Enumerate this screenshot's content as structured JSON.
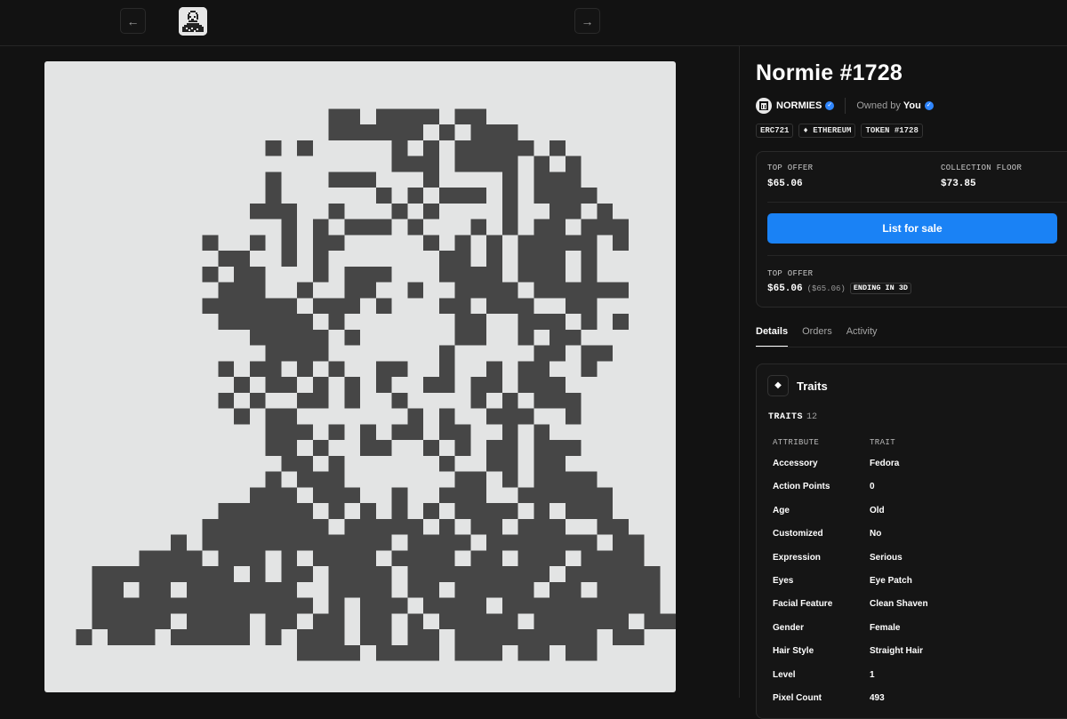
{
  "nav": {
    "prev_icon": "arrow-left-icon",
    "next_icon": "arrow-right-icon",
    "prev_glyph": "←",
    "next_glyph": "→"
  },
  "nft": {
    "title": "Normie #1728",
    "collection": "NORMIES",
    "owned_by_label": "Owned by",
    "owner": "You",
    "tags": [
      "ERC721",
      "ETHEREUM",
      "TOKEN #1728"
    ],
    "eth_glyph": "♦"
  },
  "offer": {
    "top_offer_label": "TOP OFFER",
    "top_offer_value": "$65.06",
    "floor_label": "COLLECTION FLOOR",
    "floor_value": "$73.85",
    "list_button": "List for sale",
    "bottom_label": "TOP OFFER",
    "bottom_value": "$65.06",
    "bottom_sub": "($65.06)",
    "ending": "ENDING IN 3D"
  },
  "tabs": [
    "Details",
    "Orders",
    "Activity"
  ],
  "traits": {
    "title": "Traits",
    "count_label": "TRAITS",
    "count": "12",
    "col_attribute": "ATTRIBUTE",
    "col_trait": "TRAIT",
    "rows": [
      {
        "attribute": "Accessory",
        "trait": "Fedora"
      },
      {
        "attribute": "Action Points",
        "trait": "0"
      },
      {
        "attribute": "Age",
        "trait": "Old"
      },
      {
        "attribute": "Customized",
        "trait": "No"
      },
      {
        "attribute": "Expression",
        "trait": "Serious"
      },
      {
        "attribute": "Eyes",
        "trait": "Eye Patch"
      },
      {
        "attribute": "Facial Feature",
        "trait": "Clean Shaven"
      },
      {
        "attribute": "Gender",
        "trait": "Female"
      },
      {
        "attribute": "Hair Style",
        "trait": "Straight Hair"
      },
      {
        "attribute": "Level",
        "trait": "1"
      },
      {
        "attribute": "Pixel Count",
        "trait": "493"
      }
    ]
  },
  "colors": {
    "accent": "#1a82f5",
    "pixel_dark": "#464646",
    "pixel_light": "#e3e4e4",
    "verified": "#2f86ff"
  }
}
